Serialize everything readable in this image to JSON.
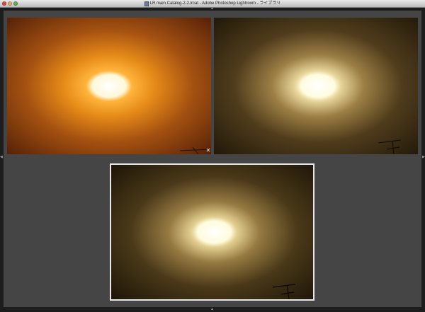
{
  "window": {
    "title": "LR main Catalog-2-2.lrcat - Adobe Photoshop Lightroom - ライブラリ"
  },
  "icons": {
    "close": "close-icon",
    "minimize": "minimize-icon",
    "zoom": "zoom-icon",
    "document": "document-icon",
    "remove": "remove-icon",
    "panel_toggle_left": "chevron-left-icon",
    "panel_toggle_right": "chevron-right-icon",
    "panel_toggle_top": "chevron-up-icon",
    "panel_toggle_bottom": "chevron-up-icon"
  },
  "glyphs": {
    "remove": "✕",
    "left": "◀",
    "right": "▶",
    "top": "▲",
    "bottom": "▲"
  },
  "colors": {
    "workspace": "#454545",
    "selection_border": "#e8e8e8"
  },
  "survey": {
    "photos": [
      {
        "id": "photo-1",
        "tone": "orange",
        "selected": false
      },
      {
        "id": "photo-2",
        "tone": "yellow-brown",
        "selected": false
      },
      {
        "id": "photo-3",
        "tone": "yellow-brown",
        "selected": true
      }
    ]
  }
}
